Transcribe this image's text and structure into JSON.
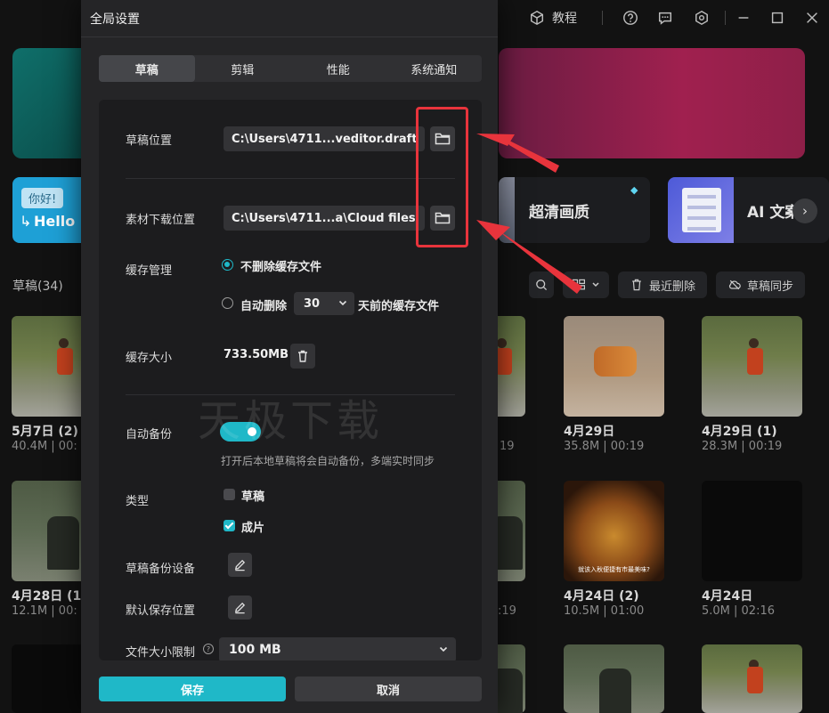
{
  "topbar": {
    "tutorial_label": "教程",
    "icons": [
      "tutorial-cube-icon",
      "help-icon",
      "feedback-icon",
      "settings-icon",
      "minimize-icon",
      "maximize-icon",
      "close-icon"
    ]
  },
  "features": {
    "left_bubble": "你好!",
    "left_hello": "Hello",
    "hd_label": "超清画质",
    "ai_label": "AI 文案",
    "next_icon": "chevron-right-icon"
  },
  "drafts": {
    "title": "草稿(34)",
    "recent_delete": "最近删除",
    "sync": "草稿同步",
    "cards": [
      {
        "title": "5月7日 (2)",
        "meta": "40.4M | 00:",
        "thumb": "walk"
      },
      {
        "title": "",
        "meta": "19",
        "thumb": "walk"
      },
      {
        "title": "4月29日",
        "meta": "35.8M | 00:19",
        "thumb": "tiger"
      },
      {
        "title": "4月29日 (1)",
        "meta": "28.3M | 00:19",
        "thumb": "walk"
      },
      {
        "title": "4月28日 (1",
        "meta": "12.1M | 00:",
        "thumb": "man"
      },
      {
        "title": "",
        "meta": ":19",
        "thumb": "man"
      },
      {
        "title": "4月24日 (2)",
        "meta": "10.5M | 01:00",
        "thumb": "food",
        "caption": "就该入秋便捷有市最美味?"
      },
      {
        "title": "4月24日",
        "meta": "5.0M | 02:16",
        "thumb": "dark"
      }
    ]
  },
  "dialog": {
    "title": "全局设置",
    "tabs": [
      "草稿",
      "剪辑",
      "性能",
      "系统通知"
    ],
    "active_tab": 0,
    "draft_location": {
      "label": "草稿位置",
      "value": "C:\\Users\\4711...veditor.draft"
    },
    "download_location": {
      "label": "素材下载位置",
      "value": "C:\\Users\\4711...a\\Cloud files"
    },
    "cache": {
      "label": "缓存管理",
      "option_keep": "不删除缓存文件",
      "option_auto": "自动删除",
      "days": "30",
      "days_suffix": "天前的缓存文件",
      "selected": "keep"
    },
    "cache_size": {
      "label": "缓存大小",
      "value": "733.50MB"
    },
    "auto_backup": {
      "label": "自动备份",
      "enabled": true,
      "hint": "打开后本地草稿将会自动备份，多端实时同步"
    },
    "type": {
      "label": "类型",
      "draft": "草稿",
      "draft_checked": false,
      "film": "成片",
      "film_checked": true
    },
    "backup_device_label": "草稿备份设备",
    "default_save_label": "默认保存位置",
    "file_limit": {
      "label": "文件大小限制",
      "value": "100 MB"
    },
    "save_label": "保存",
    "cancel_label": "取消"
  },
  "watermark": "天极下载",
  "colors": {
    "accent": "#1fb8c8",
    "annotation": "#e8343c",
    "dialog_bg": "#252527",
    "panel_bg": "#1c1c1e"
  }
}
